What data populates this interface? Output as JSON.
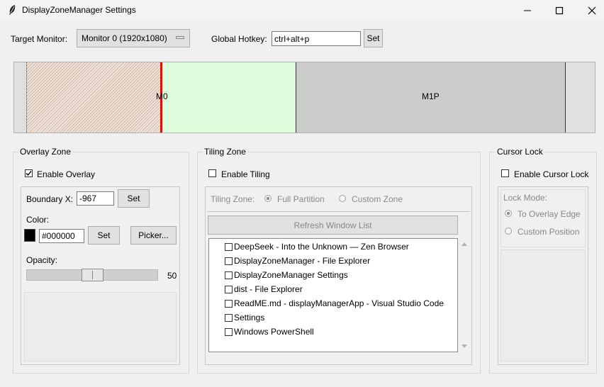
{
  "window": {
    "title": "DisplayZoneManager Settings",
    "minimize_glyph": "—",
    "maximize_glyph": "☐",
    "close_glyph": "✕"
  },
  "top": {
    "monitor_label": "Target Monitor:",
    "monitor_value": "Monitor 0 (1920x1080)",
    "hotkey_label": "Global Hotkey:",
    "hotkey_value": "ctrl+alt+p",
    "set_label": "Set"
  },
  "canvas": {
    "m0_label": "M0",
    "m1_label": "M1P"
  },
  "overlay": {
    "group_title": "Overlay Zone",
    "enable_label": "Enable Overlay",
    "enabled": true,
    "boundary_label": "Boundary X:",
    "boundary_value": "-967",
    "boundary_set_label": "Set",
    "color_label": "Color:",
    "color_value": "#000000",
    "color_set_label": "Set",
    "picker_label": "Picker...",
    "opacity_label": "Opacity:",
    "opacity_value": "50"
  },
  "tiling": {
    "group_title": "Tiling Zone",
    "enable_label": "Enable Tiling",
    "enabled": false,
    "zone_label": "Tiling Zone:",
    "full_partition_label": "Full Partition",
    "custom_zone_label": "Custom Zone",
    "refresh_label": "Refresh Window List",
    "windows": [
      "DeepSeek - Into the Unknown — Zen Browser",
      "DisplayZoneManager - File Explorer",
      "DisplayZoneManager Settings",
      "dist - File Explorer",
      "ReadME.md - displayManagerApp - Visual Studio Code",
      "Settings",
      "Windows PowerShell"
    ]
  },
  "cursor": {
    "group_title": "Cursor Lock",
    "enable_label": "Enable Cursor Lock",
    "enabled": false,
    "lock_mode_label": "Lock Mode:",
    "to_edge_label": "To Overlay Edge",
    "custom_position_label": "Custom Position"
  },
  "colors": {
    "boundary_line": "#ff0000",
    "m0_right_fill": "#dcfcdc",
    "m1_fill": "#cccccc",
    "overlay_hatch": "#efe2d8"
  }
}
